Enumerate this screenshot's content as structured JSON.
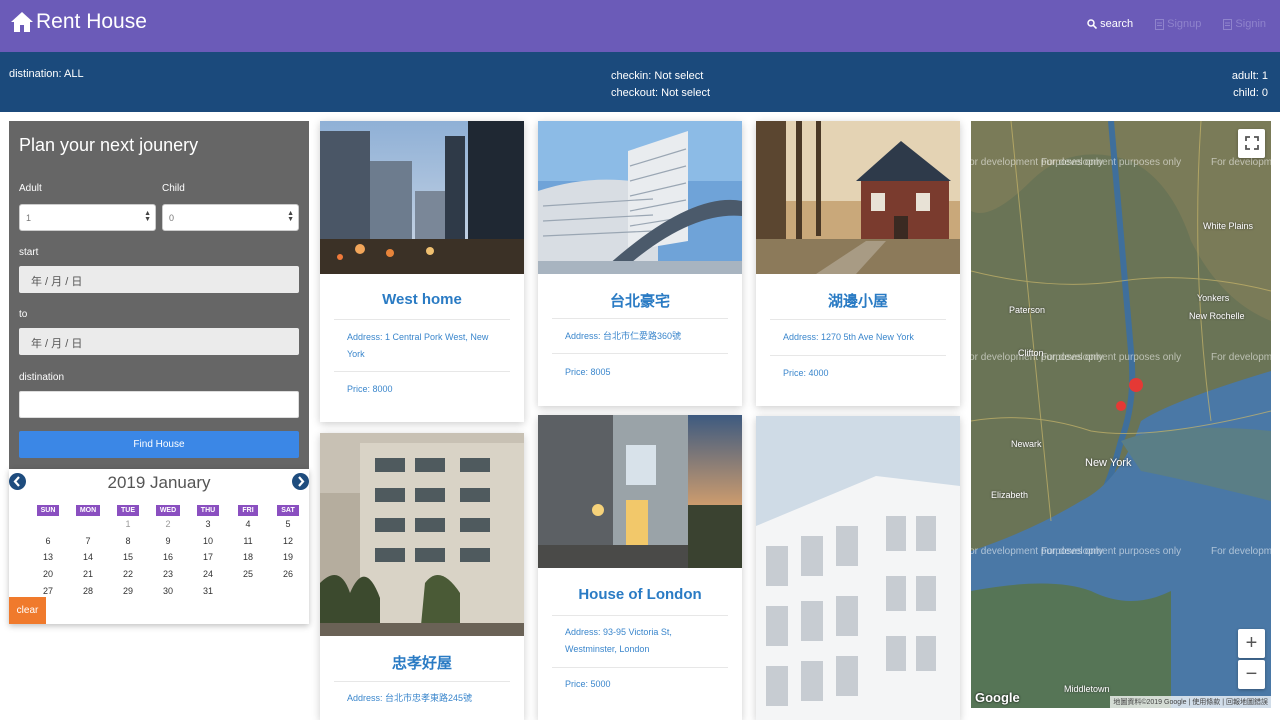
{
  "app": {
    "brand": "Rent House"
  },
  "nav": {
    "search": "search",
    "signup": "Signup",
    "signin": "Signin"
  },
  "info": {
    "destination": "distination: ALL",
    "checkin": "checkin: Not select",
    "checkout": "checkout: Not select",
    "adult": "adult: 1",
    "child": "child: 0"
  },
  "planner": {
    "title": "Plan your next jounery",
    "adult_label": "Adult",
    "adult_value": "1",
    "child_label": "Child",
    "child_value": "0",
    "start_label": "start",
    "start_placeholder": "年 / 月 / 日",
    "to_label": "to",
    "to_placeholder": "年 / 月 / 日",
    "destination_label": "distination",
    "destination_value": "",
    "find_button": "Find House"
  },
  "calendar": {
    "title": "2019 January",
    "weekdays": [
      "SUN",
      "MON",
      "TUE",
      "WED",
      "THU",
      "FRI",
      "SAT"
    ],
    "rows": [
      [
        "",
        "",
        "1",
        "2",
        "3",
        "4",
        "5"
      ],
      [
        "6",
        "7",
        "8",
        "9",
        "10",
        "11",
        "12"
      ],
      [
        "13",
        "14",
        "15",
        "16",
        "17",
        "18",
        "19"
      ],
      [
        "20",
        "21",
        "22",
        "23",
        "24",
        "25",
        "26"
      ],
      [
        "27",
        "28",
        "29",
        "30",
        "31",
        "",
        ""
      ]
    ],
    "clear": "clear"
  },
  "listings": [
    {
      "title": "West home",
      "address": "Address: 1 Central Pork West, New York",
      "price": "Price: 8000"
    },
    {
      "title": "台北豪宅",
      "address": "Address: 台北市仁愛路360號",
      "price": "Price: 8005"
    },
    {
      "title": "湖邊小屋",
      "address": "Address: 1270 5th Ave New York",
      "price": "Price: 4000"
    },
    {
      "title": "忠孝好屋",
      "address": "Address: 台北市忠孝東路245號",
      "price": ""
    },
    {
      "title": "House of London",
      "address": "Address: 93-95 Victoria St, Westminster, London",
      "price": "Price: 5000"
    }
  ],
  "map": {
    "watermark": "For development purposes only",
    "cities": [
      "Paterson",
      "Yonkers",
      "New Rochelle",
      "White Plains",
      "Clifton",
      "Newark",
      "New York",
      "Elizabeth",
      "Middletown"
    ],
    "logo": "Google",
    "copyright": "地圖資料©2019 Google | 使用條款 | 回報地圖錯誤",
    "zoom_in": "+",
    "zoom_out": "−"
  }
}
